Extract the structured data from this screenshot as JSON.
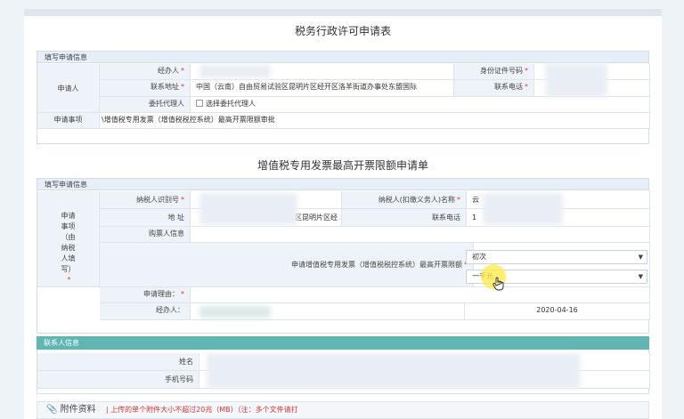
{
  "colors": {
    "accent_header": "#5fb6b2",
    "required": "#e33333",
    "label_bg": "#eef3f9"
  },
  "form1": {
    "title": "税务行政许可申请表",
    "section_header": "填写申请信息",
    "applicant_label": "申请人",
    "handler_label": "经办人",
    "id_label": "身份证件号码",
    "address_label": "联系地址",
    "address_value": "中国（云南）自由贸易试验区昆明片区经开区洛羊街道办事处东盟国际",
    "phone_label": "联系电话",
    "agent_label": "委托代理人",
    "agent_checkbox_label": "选择委托代理人",
    "item_label": "申请事项",
    "item_value": "\\增值税专用发票（增值税税控系统）最高开票限额审批"
  },
  "form2": {
    "title": "增值税专用发票最高开票限额申请单",
    "section_header": "填写申请信息",
    "side_label": "申请事项（由纳税人填写）",
    "taxpayer_id_label": "纳税人识别号",
    "taxpayer_name_label": "纳税人(扣缴义务人)名称",
    "taxpayer_name_value": "云",
    "address_label": "地 址",
    "address_value": "区昆明片区经",
    "phone_label": "联系电话",
    "phone_value": "1",
    "buyer_label": "购票人信息",
    "limit_label": "申请增值税专用发票（增值税税控系统）最高开票限额",
    "select1_value": "初次",
    "select2_value": "一千元",
    "reason_label": "申请理由：",
    "handler_label": "经办人：",
    "date_value": "2020-04-16"
  },
  "contact": {
    "header": "联系人信息",
    "name_label": "姓名",
    "phone_label": "手机号码"
  },
  "attachment": {
    "title": "附件资料",
    "notice": "上传的单个附件大小不超过20兆（MB）（注：多个文件请打"
  }
}
